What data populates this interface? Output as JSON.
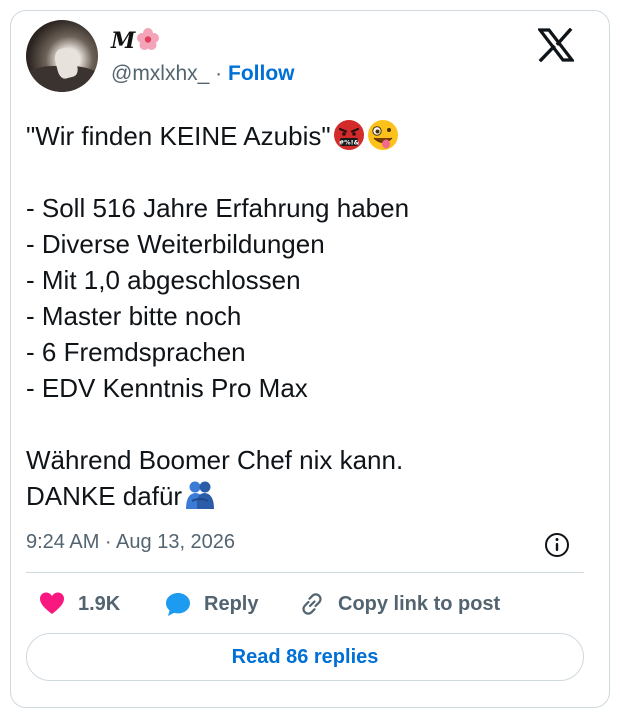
{
  "author": {
    "display_name": "M",
    "display_emoji": "flower-emoji",
    "handle": "@mxlxhx_",
    "separator": " · ",
    "follow_label": "Follow"
  },
  "tweet": {
    "line1": "\"Wir finden KEINE Azubis\"",
    "list": [
      "- Soll 516 Jahre Erfahrung haben",
      "- Diverse Weiterbildungen",
      "- Mit 1,0 abgeschlossen",
      "- Master bitte noch",
      "- 6 Fremdsprachen",
      "- EDV Kenntnis Pro Max"
    ],
    "closing1": "Während Boomer Chef nix kann.",
    "closing2": "DANKE dafür"
  },
  "timestamp": "9:24 AM · Aug 13, 2026",
  "actions": {
    "likes": "1.9K",
    "reply_label": "Reply",
    "copy_label": "Copy link to post"
  },
  "read_replies_label": "Read 86 replies",
  "colors": {
    "link_blue": "#006fd6",
    "like_pink": "#f91880",
    "reply_blue": "#1d9bf0",
    "muted": "#536471",
    "border": "#cfd9de"
  }
}
